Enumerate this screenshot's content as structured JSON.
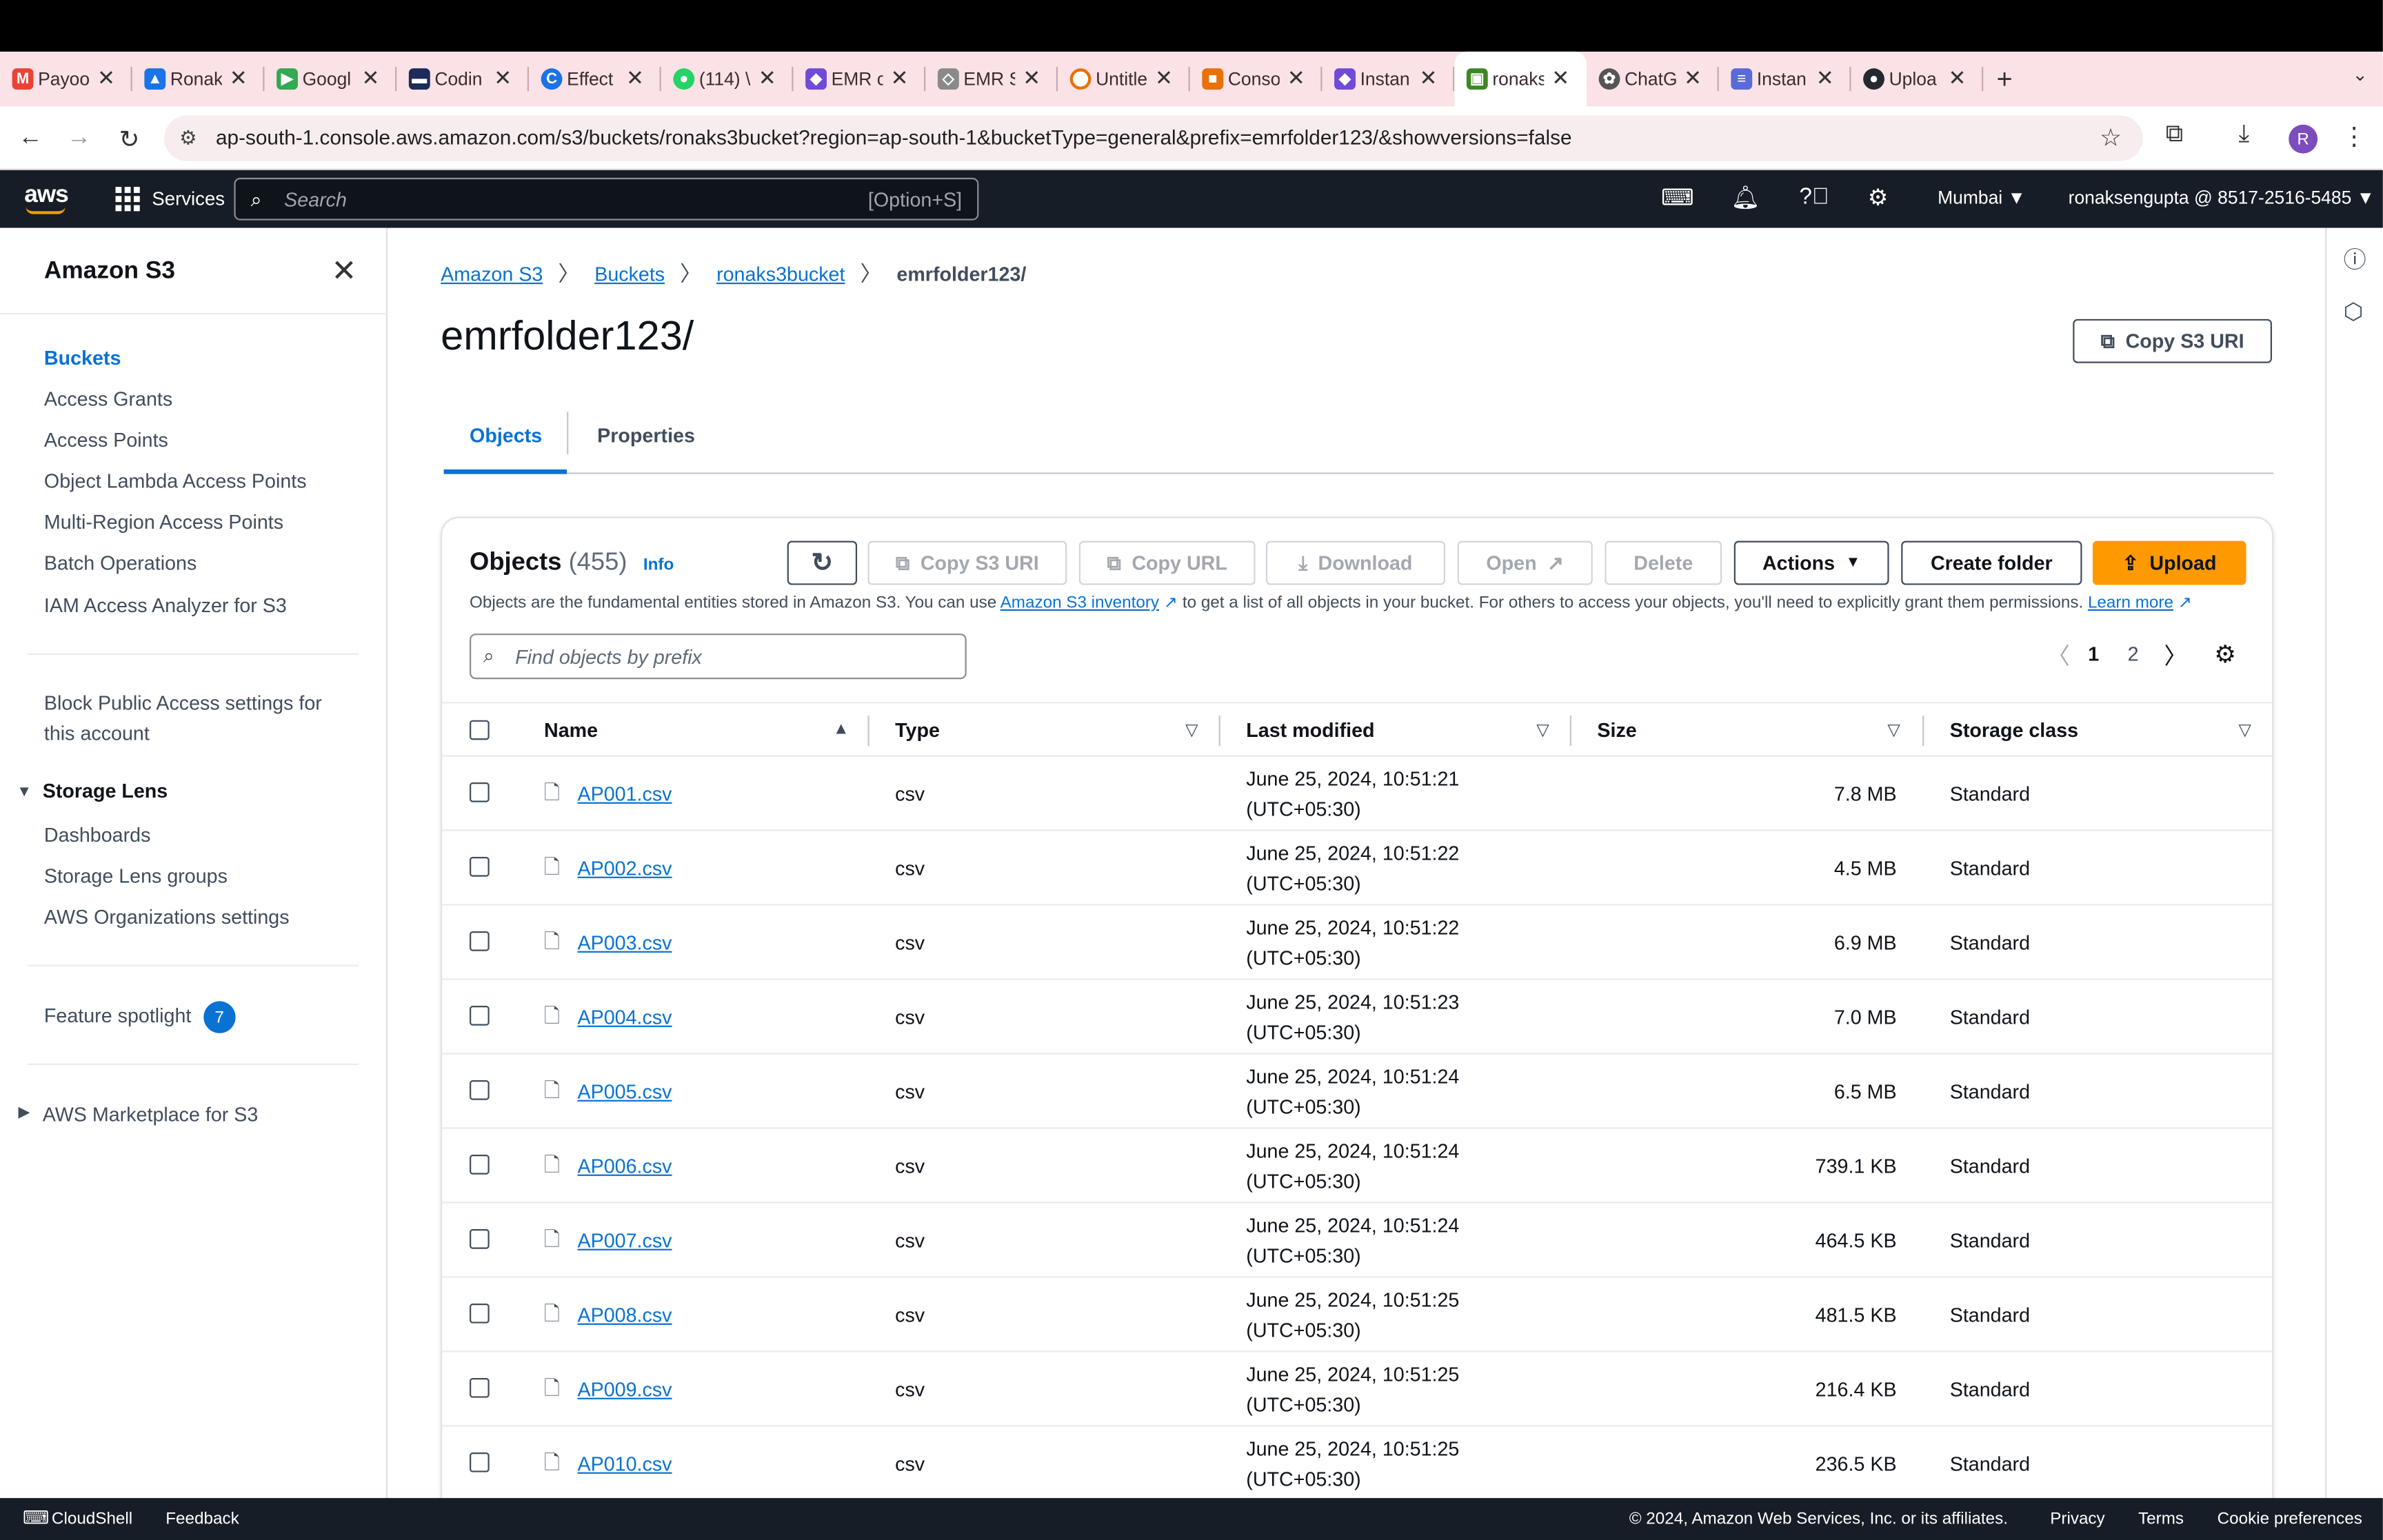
{
  "browser": {
    "tabs": [
      {
        "label": "Payoo",
        "icon_color": "#ea4335",
        "icon": "gmail-icon"
      },
      {
        "label": "Ronak",
        "icon_color": "#1a73e8",
        "icon": "drive-icon"
      },
      {
        "label": "Googl",
        "icon_color": "#34a853",
        "icon": "meet-icon"
      },
      {
        "label": "Codin",
        "icon_color": "#1c2b5a",
        "icon": "code-icon"
      },
      {
        "label": "Effect",
        "icon_color": "#1a73e8",
        "icon": "c-icon"
      },
      {
        "label": "(114) \\",
        "icon_color": "#25d366",
        "icon": "chat-icon"
      },
      {
        "label": "EMR c",
        "icon_color": "#6f4bd8",
        "icon": "emr-icon"
      },
      {
        "label": "EMR S",
        "icon_color": "#8a8a8a",
        "icon": "cube-icon"
      },
      {
        "label": "Untitle",
        "icon_color": "#e8710a",
        "icon": "spinner-icon"
      },
      {
        "label": "Conso",
        "icon_color": "#e8710a",
        "icon": "box-icon"
      },
      {
        "label": "Instan",
        "icon_color": "#6f4bd8",
        "icon": "instance-icon"
      },
      {
        "label": "ronaks",
        "icon_color": "#3f8624",
        "icon": "s3-icon",
        "active": true
      },
      {
        "label": "ChatG",
        "icon_color": "#555555",
        "icon": "openai-icon"
      },
      {
        "label": "Instan",
        "icon_color": "#5a6bd8",
        "icon": "stack-icon"
      },
      {
        "label": "Uploa",
        "icon_color": "#24292f",
        "icon": "github-icon"
      }
    ],
    "url": "ap-south-1.console.aws.amazon.com/s3/buckets/ronaks3bucket?region=ap-south-1&bucketType=general&prefix=emrfolder123/&showversions=false",
    "profile_initial": "R"
  },
  "awsnav": {
    "logo": "aws",
    "services": "Services",
    "search_placeholder": "Search",
    "search_shortcut": "[Option+S]",
    "region": "Mumbai ▼",
    "account": "ronaksengupta @ 8517-2516-5485 ▼"
  },
  "sidebar": {
    "title": "Amazon S3",
    "items": [
      "Buckets",
      "Access Grants",
      "Access Points",
      "Object Lambda Access Points",
      "Multi-Region Access Points",
      "Batch Operations",
      "IAM Access Analyzer for S3"
    ],
    "block_public_1": "Block Public Access settings for",
    "block_public_2": "this account",
    "storage_lens": "Storage Lens",
    "storage_lens_items": [
      "Dashboards",
      "Storage Lens groups",
      "AWS Organizations settings"
    ],
    "feature_spotlight": "Feature spotlight",
    "feature_count": "7",
    "marketplace": "AWS Marketplace for S3"
  },
  "breadcrumb": [
    "Amazon S3",
    "Buckets",
    "ronaks3bucket",
    "emrfolder123/"
  ],
  "page_title": "emrfolder123/",
  "copy_s3_uri": "Copy S3 URI",
  "tabs": [
    "Objects",
    "Properties"
  ],
  "objects": {
    "title": "Objects",
    "count": "(455)",
    "info": "Info",
    "toolbar": {
      "copy_uri": "Copy S3 URI",
      "copy_url": "Copy URL",
      "download": "Download",
      "open": "Open",
      "delete": "Delete",
      "actions": "Actions",
      "create_folder": "Create folder",
      "upload": "Upload"
    },
    "desc_1": "Objects are the fundamental entities stored in Amazon S3. You can use ",
    "desc_link": "Amazon S3 inventory",
    "desc_2": " to get a list of all objects in your bucket. For others to access your objects, you'll need to explicitly grant them permissions. ",
    "learn_more": "Learn more",
    "filter_placeholder": "Find objects by prefix",
    "pages": [
      "1",
      "2"
    ],
    "columns": [
      "Name",
      "Type",
      "Last modified",
      "Size",
      "Storage class"
    ],
    "rows": [
      {
        "name": "AP001.csv",
        "type": "csv",
        "date": "June 25, 2024, 10:51:21",
        "tz": "(UTC+05:30)",
        "size": "7.8 MB",
        "class": "Standard"
      },
      {
        "name": "AP002.csv",
        "type": "csv",
        "date": "June 25, 2024, 10:51:22",
        "tz": "(UTC+05:30)",
        "size": "4.5 MB",
        "class": "Standard"
      },
      {
        "name": "AP003.csv",
        "type": "csv",
        "date": "June 25, 2024, 10:51:22",
        "tz": "(UTC+05:30)",
        "size": "6.9 MB",
        "class": "Standard"
      },
      {
        "name": "AP004.csv",
        "type": "csv",
        "date": "June 25, 2024, 10:51:23",
        "tz": "(UTC+05:30)",
        "size": "7.0 MB",
        "class": "Standard"
      },
      {
        "name": "AP005.csv",
        "type": "csv",
        "date": "June 25, 2024, 10:51:24",
        "tz": "(UTC+05:30)",
        "size": "6.5 MB",
        "class": "Standard"
      },
      {
        "name": "AP006.csv",
        "type": "csv",
        "date": "June 25, 2024, 10:51:24",
        "tz": "(UTC+05:30)",
        "size": "739.1 KB",
        "class": "Standard"
      },
      {
        "name": "AP007.csv",
        "type": "csv",
        "date": "June 25, 2024, 10:51:24",
        "tz": "(UTC+05:30)",
        "size": "464.5 KB",
        "class": "Standard"
      },
      {
        "name": "AP008.csv",
        "type": "csv",
        "date": "June 25, 2024, 10:51:25",
        "tz": "(UTC+05:30)",
        "size": "481.5 KB",
        "class": "Standard"
      },
      {
        "name": "AP009.csv",
        "type": "csv",
        "date": "June 25, 2024, 10:51:25",
        "tz": "(UTC+05:30)",
        "size": "216.4 KB",
        "class": "Standard"
      },
      {
        "name": "AP010.csv",
        "type": "csv",
        "date": "June 25, 2024, 10:51:25",
        "tz": "(UTC+05:30)",
        "size": "236.5 KB",
        "class": "Standard"
      }
    ]
  },
  "footer": {
    "cloudshell": "CloudShell",
    "feedback": "Feedback",
    "copyright": "© 2024, Amazon Web Services, Inc. or its affiliates.",
    "privacy": "Privacy",
    "terms": "Terms",
    "cookies": "Cookie preferences"
  },
  "colors": {
    "link": "#0972d3",
    "upload": "#ff9900",
    "nav": "#161d26"
  }
}
